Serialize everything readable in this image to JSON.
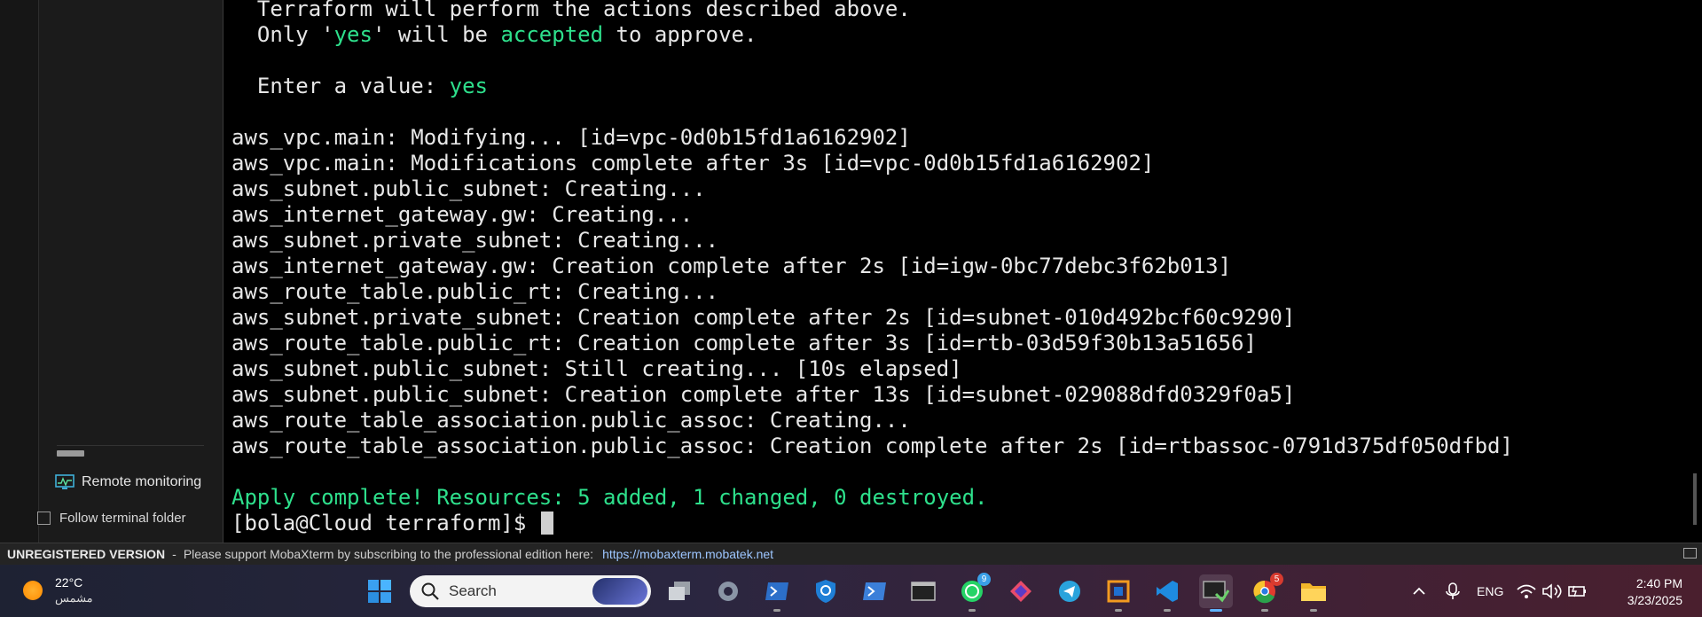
{
  "sidebar": {
    "remote_monitoring": "Remote monitoring",
    "follow_terminal_folder": "Follow terminal folder"
  },
  "terminal": {
    "lines": [
      {
        "segments": [
          {
            "text": "  Terraform will perform the actions described above."
          }
        ]
      },
      {
        "segments": [
          {
            "text": "  Only '"
          },
          {
            "text": "yes",
            "color": "green"
          },
          {
            "text": "' will be "
          },
          {
            "text": "accepted",
            "color": "green"
          },
          {
            "text": " to approve."
          }
        ]
      },
      {
        "segments": [
          {
            "text": ""
          }
        ]
      },
      {
        "segments": [
          {
            "text": "  Enter a value: "
          },
          {
            "text": "yes",
            "color": "green"
          }
        ]
      },
      {
        "segments": [
          {
            "text": ""
          }
        ]
      },
      {
        "segments": [
          {
            "text": "aws_vpc.main: Modifying... [id=vpc-0d0b15fd1a6162902]"
          }
        ]
      },
      {
        "segments": [
          {
            "text": "aws_vpc.main: Modifications complete after 3s [id=vpc-0d0b15fd1a6162902]"
          }
        ]
      },
      {
        "segments": [
          {
            "text": "aws_subnet.public_subnet: Creating..."
          }
        ]
      },
      {
        "segments": [
          {
            "text": "aws_internet_gateway.gw: Creating..."
          }
        ]
      },
      {
        "segments": [
          {
            "text": "aws_subnet.private_subnet: Creating..."
          }
        ]
      },
      {
        "segments": [
          {
            "text": "aws_internet_gateway.gw: Creation complete after 2s [id=igw-0bc77debc3f62b013]"
          }
        ]
      },
      {
        "segments": [
          {
            "text": "aws_route_table.public_rt: Creating..."
          }
        ]
      },
      {
        "segments": [
          {
            "text": "aws_subnet.private_subnet: Creation complete after 2s [id=subnet-010d492bcf60c9290]"
          }
        ]
      },
      {
        "segments": [
          {
            "text": "aws_route_table.public_rt: Creation complete after 3s [id=rtb-03d59f30b13a51656]"
          }
        ]
      },
      {
        "segments": [
          {
            "text": "aws_subnet.public_subnet: Still creating... [10s elapsed]"
          }
        ]
      },
      {
        "segments": [
          {
            "text": "aws_subnet.public_subnet: Creation complete after 13s [id=subnet-029088dfd0329f0a5]"
          }
        ]
      },
      {
        "segments": [
          {
            "text": "aws_route_table_association.public_assoc: Creating..."
          }
        ]
      },
      {
        "segments": [
          {
            "text": "aws_route_table_association.public_assoc: Creation complete after 2s [id=rtbassoc-0791d375df050dfbd]"
          }
        ]
      },
      {
        "segments": [
          {
            "text": ""
          }
        ]
      },
      {
        "segments": [
          {
            "text": "Apply complete! Resources: 5 added, 1 changed, 0 destroyed.",
            "color": "green"
          }
        ]
      },
      {
        "segments": [
          {
            "text": "[bola@Cloud terraform]$ "
          }
        ],
        "cursor": true
      }
    ]
  },
  "statusbar": {
    "unregistered": "UNREGISTERED VERSION",
    "separator": "-",
    "message": "Please support MobaXterm by subscribing to the professional edition here:",
    "link": "https://mobaxterm.mobatek.net"
  },
  "taskbar": {
    "weather_temp": "22°C",
    "weather_desc": "مشمس",
    "search_label": "Search",
    "whatsapp_badge": "9",
    "chrome_badge": "5",
    "language": "ENG",
    "time": "2:40 PM",
    "date": "3/23/2025"
  },
  "colors": {
    "terminal_green": "#2ee08c",
    "terminal_text": "#e7e7e7",
    "link_blue": "#9dc6ff"
  }
}
